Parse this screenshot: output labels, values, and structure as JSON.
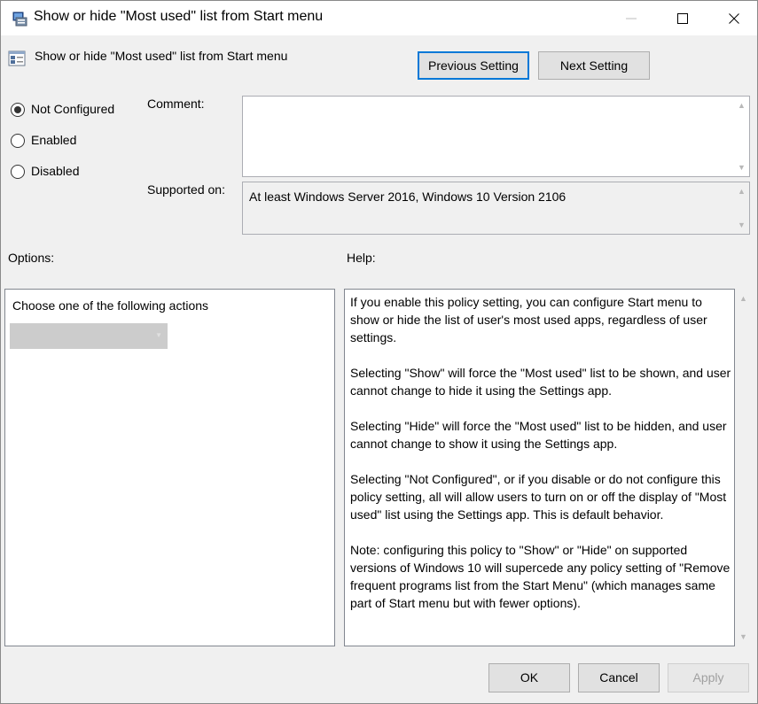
{
  "window": {
    "title": "Show or hide \"Most used\" list from Start menu",
    "controls": {
      "minimize": "minimize",
      "maximize": "maximize",
      "close": "close"
    }
  },
  "header": {
    "policy_name": "Show or hide \"Most used\" list from Start menu",
    "previous_button": "Previous Setting",
    "next_button": "Next Setting"
  },
  "state": {
    "options": [
      {
        "label": "Not Configured",
        "checked": true
      },
      {
        "label": "Enabled",
        "checked": false
      },
      {
        "label": "Disabled",
        "checked": false
      }
    ]
  },
  "fields": {
    "comment_label": "Comment:",
    "comment_value": "",
    "supported_label": "Supported on:",
    "supported_value": "At least Windows Server 2016, Windows 10 Version 2106"
  },
  "options_section": {
    "label": "Options:",
    "caption": "Choose one of the following actions",
    "dropdown_value": ""
  },
  "help_section": {
    "label": "Help:",
    "paragraphs": [
      "If you enable this policy setting, you can configure Start menu to show or hide the list of user's most used apps, regardless of user settings.",
      "Selecting \"Show\" will force the \"Most used\" list to be shown, and user cannot change to hide it using the Settings app.",
      "Selecting \"Hide\" will force the \"Most used\" list to be hidden, and user cannot change to show it using the Settings app.",
      "Selecting \"Not Configured\", or if you disable or do not configure this policy setting, all will allow users to turn on or off the display of \"Most used\" list using the Settings app. This is default behavior.",
      "Note: configuring this policy to \"Show\" or \"Hide\" on supported versions of Windows 10 will supercede any policy setting of \"Remove frequent programs list from the Start Menu\" (which manages same part of Start menu but with fewer options)."
    ]
  },
  "footer": {
    "ok": "OK",
    "cancel": "Cancel",
    "apply": "Apply"
  },
  "colors": {
    "focus_accent": "#0078d7",
    "window_bg": "#f0f0f0"
  },
  "icons": {
    "title": "policy-app-icon",
    "policy": "policy-setting-icon",
    "scroll_up": "chevron-up-icon",
    "scroll_down": "chevron-down-icon"
  }
}
